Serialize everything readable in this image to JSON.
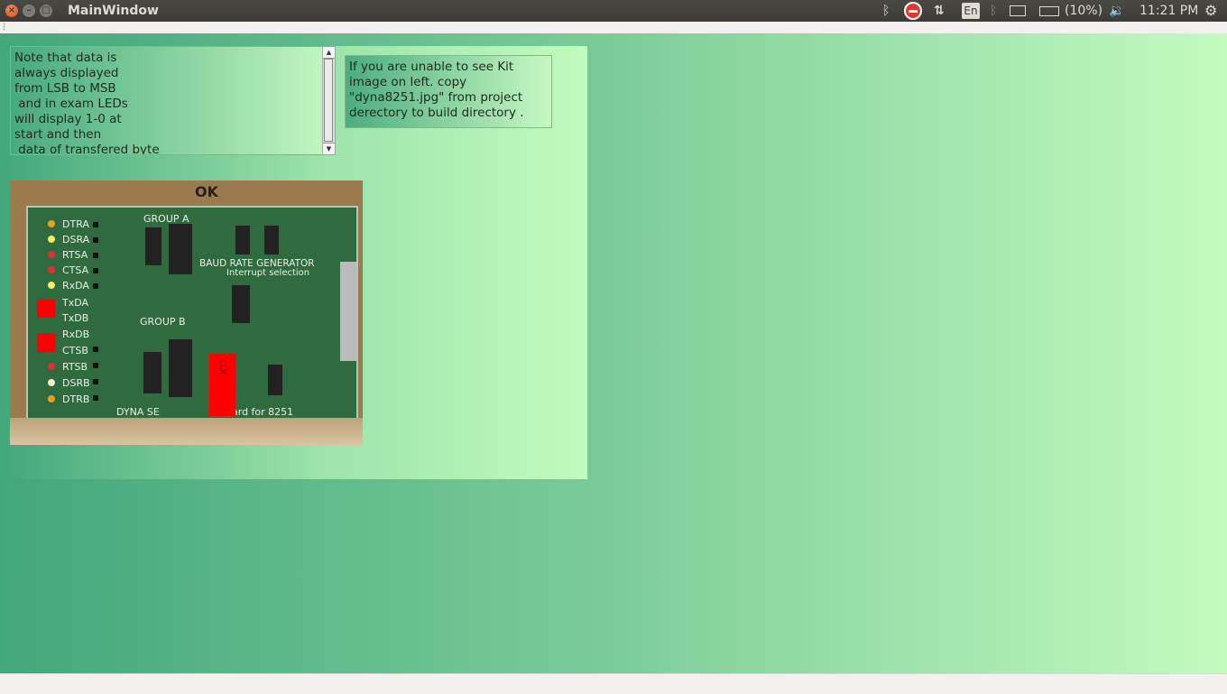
{
  "topbar": {
    "window_title": "MainWindow",
    "close_glyph": "×",
    "minimize_glyph": "–",
    "maximize_glyph": "□",
    "bluetooth_glyph": "ᛒ",
    "network_glyph": "⇅",
    "keyboard_layout": "En",
    "battery_text": "(10%)",
    "volume_glyph": "🔉",
    "clock": "11:21 PM",
    "settings_glyph": "⚙"
  },
  "main": {
    "note_text": "Note that data is\nalways displayed\nfrom LSB to MSB\n and in exam LEDs\nwill display 1-0 at\nstart and then\n data of transfered byte",
    "info_text": "If you are unable to see Kit\nimage on left. copy\n\"dyna8251.jpg\" from project\nderectory to build directory .",
    "scroll_up_glyph": "▲",
    "scroll_down_glyph": "▼"
  },
  "kit_image": {
    "handwritten_mark": "OK",
    "labels": [
      "DTRA",
      "DSRA",
      "RTSA",
      "CTSA",
      "RxDA",
      "TxDA",
      "TxDB",
      "RxDB",
      "CTSB",
      "RTSB",
      "DSRB",
      "DTRB"
    ],
    "group_a": "GROUP A",
    "group_b": "GROUP B",
    "baud_title": "BAUD RATE GENERATOR",
    "interrupt_title": "Interrupt selection",
    "footer": "DYNA SE",
    "footer2": "ard for 8251",
    "clk_label": "CLK"
  }
}
